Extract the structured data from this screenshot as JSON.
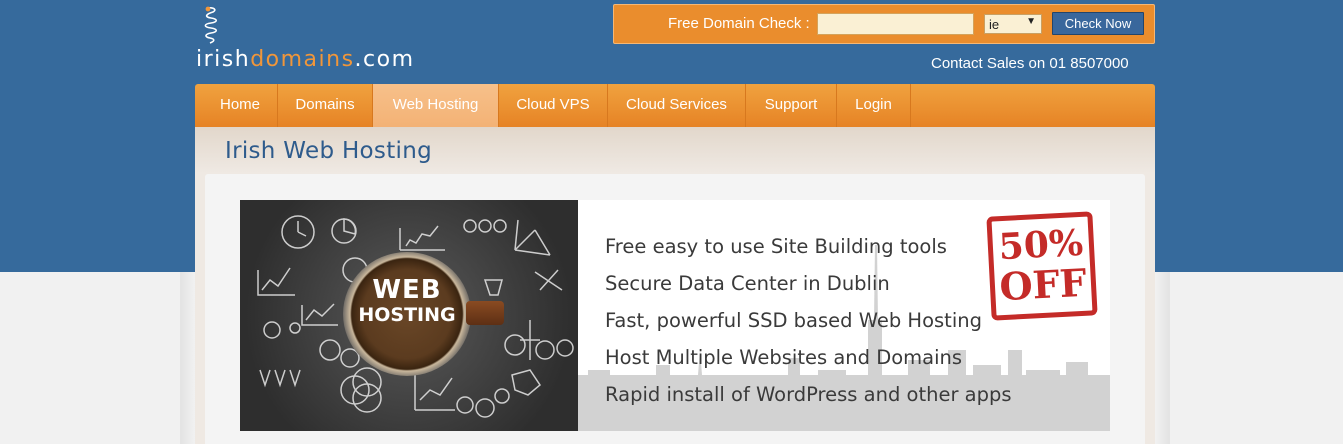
{
  "logo": {
    "word_white_1": "irish",
    "word_orange": "domains",
    "word_white_2": ".com"
  },
  "domain_check": {
    "label": "Free Domain Check :",
    "input_value": "",
    "tld_selected": "ie",
    "button_label": "Check Now"
  },
  "contact": "Contact Sales on 01 8507000",
  "nav": {
    "items": [
      {
        "label": "Home"
      },
      {
        "label": "Domains"
      },
      {
        "label": "Web Hosting"
      },
      {
        "label": "Cloud VPS"
      },
      {
        "label": "Cloud Services"
      },
      {
        "label": "Support"
      },
      {
        "label": "Login"
      }
    ],
    "active": "Web Hosting"
  },
  "page": {
    "title": "Irish Web Hosting"
  },
  "banner": {
    "cup_line1": "WEB",
    "cup_line2": "HOSTING",
    "features": [
      "Free easy to use Site Building tools",
      "Secure Data Center in Dublin",
      "Fast, powerful SSD based Web Hosting",
      "Host Multiple Websites and Domains",
      "Rapid install of WordPress and other apps"
    ],
    "stamp_line1": "50%",
    "stamp_line2": "OFF"
  },
  "colors": {
    "header_blue": "#366a9c",
    "accent_orange": "#ea8d2d",
    "title_blue": "#2e5b8c",
    "stamp_red": "#c42b28"
  }
}
